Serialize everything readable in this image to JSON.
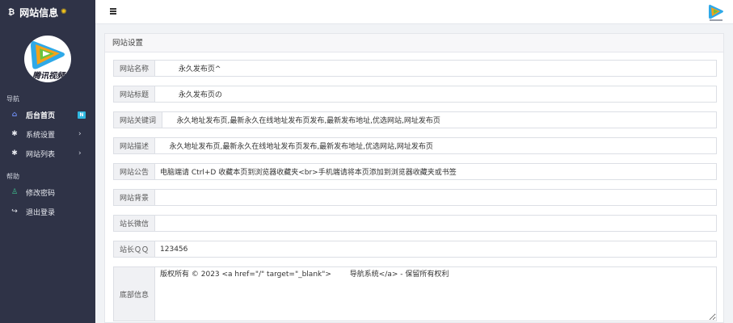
{
  "sidebar": {
    "brand": {
      "icon_char": "₿",
      "title": "网站信息",
      "star_char": "✺"
    },
    "avatar_text": "腾讯视频",
    "section_nav": "导航",
    "nav_items": [
      {
        "label": "后台首页",
        "badge": "N"
      },
      {
        "label": "系统设置",
        "chevron": "›"
      },
      {
        "label": "网站列表",
        "chevron": "›"
      }
    ],
    "section_help": "帮助",
    "help_items": [
      {
        "label": "修改密码"
      },
      {
        "label": "退出登录"
      }
    ]
  },
  "card": {
    "title": "网站设置",
    "fields": [
      {
        "label": "网站名称",
        "value": "        永久发布页^"
      },
      {
        "label": "网站标题",
        "value": "        永久发布页の"
      },
      {
        "label": "网站关键词",
        "value": "    永久地址发布页,最新永久在线地址发布页发布,最新发布地址,优选网站,网址发布页"
      },
      {
        "label": "网站描述",
        "value": "    永久地址发布页,最新永久在线地址发布页发布,最新发布地址,优选网站,网址发布页"
      },
      {
        "label": "网站公告",
        "value": "电脑端请 Ctrl+D 收藏本页到浏览器收藏夹<br>手机端请将本页添加到浏览器收藏夹或书签"
      },
      {
        "label": "网站背景",
        "value": ""
      },
      {
        "label": "站长微信",
        "value": ""
      },
      {
        "label": "站长ＱＱ",
        "value": "123456"
      },
      {
        "label": "底部信息",
        "value": "版权所有 © 2023 <a href=\"/\" target=\"_blank\">        导航系统</a> - 保留所有权利"
      }
    ]
  },
  "colors": {
    "sidebar_bg": "#2f3347",
    "active_icon": "#6d8cf0",
    "badge_bg": "#2fb8e0",
    "key_icon": "#3ec08e"
  }
}
